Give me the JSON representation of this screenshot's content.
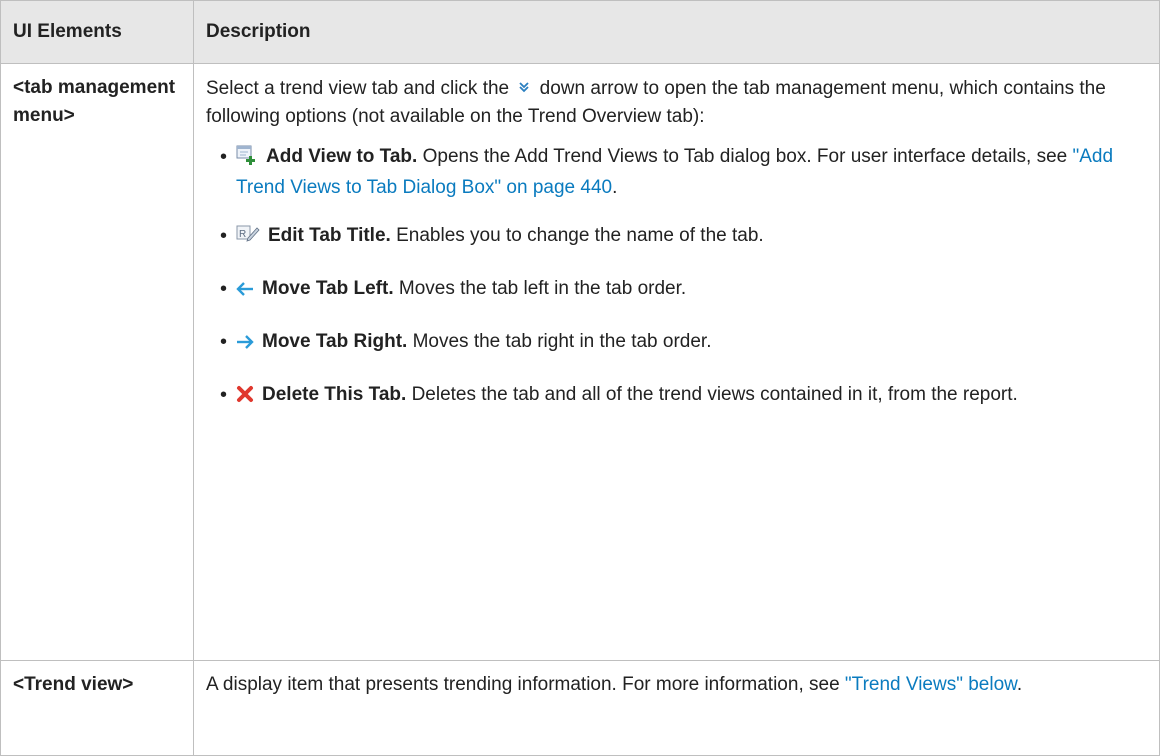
{
  "table": {
    "headers": [
      "UI Elements",
      "Description"
    ],
    "rows": [
      {
        "element": "<tab management menu>",
        "intro_before_icon": "Select a trend view tab and click the",
        "intro_icon": "double-chevron-down-icon",
        "intro_after_icon": "down arrow to open the tab management menu, which contains the following options (not available on the Trend Overview tab):",
        "options": [
          {
            "icon": "add-view-icon",
            "label": "Add View to Tab.",
            "text": "Opens the Add Trend Views to Tab dialog box. For user interface details, see",
            "link": "\"Add Trend Views to Tab Dialog Box\" on page 440",
            "after": "."
          },
          {
            "icon": "edit-title-icon",
            "label": "Edit Tab Title.",
            "text": "Enables you to change the name of the tab."
          },
          {
            "icon": "arrow-left-icon",
            "label": "Move Tab Left.",
            "text": "Moves the tab left in the tab order."
          },
          {
            "icon": "arrow-right-icon",
            "label": "Move Tab Right.",
            "text": "Moves the tab right in the tab order."
          },
          {
            "icon": "delete-x-icon",
            "label": "Delete This Tab.",
            "text": "Deletes the tab and all of the trend views contained in it, from the report."
          }
        ]
      },
      {
        "element": "<Trend view>",
        "text": "A display item that presents trending information. For more information, see",
        "link": "\"Trend Views\" below",
        "after": "."
      }
    ]
  },
  "colors": {
    "header_bg": "#e7e7e7",
    "border": "#bfbfbf",
    "link": "#0a7bbf",
    "delete_icon": "#e0382e",
    "arrow_icon": "#2a9bd8"
  }
}
